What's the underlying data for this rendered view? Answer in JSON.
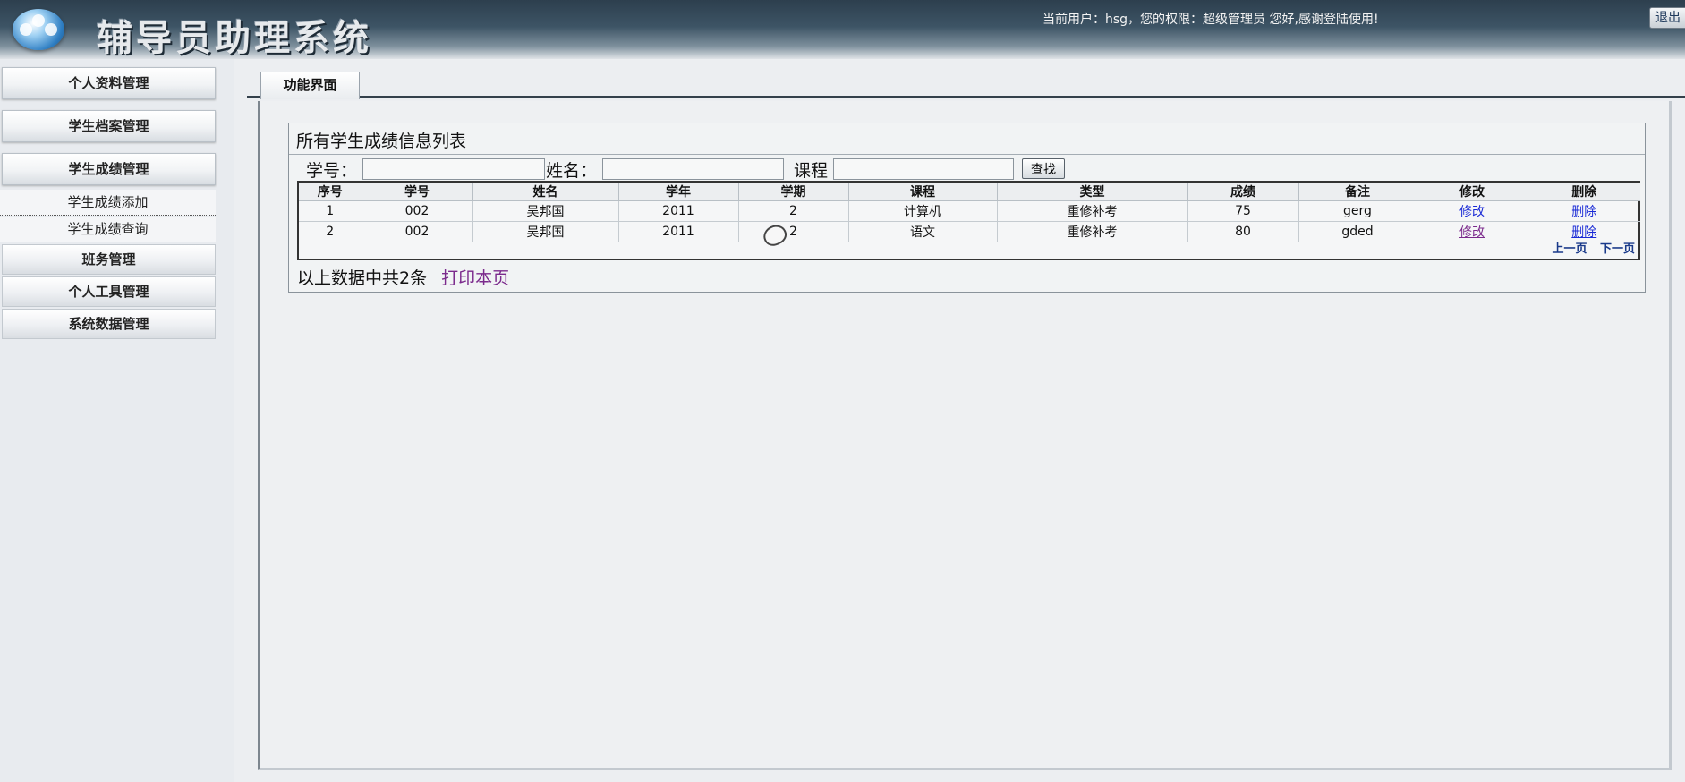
{
  "header": {
    "title": "辅导员助理系统",
    "user_info": "当前用户：hsg，您的权限：超级管理员  您好,感谢登陆使用!",
    "logout_label": "退出"
  },
  "sidebar": {
    "menus": [
      {
        "label": "个人资料管理"
      },
      {
        "label": "学生档案管理"
      },
      {
        "label": "学生成绩管理"
      }
    ],
    "sub_items": [
      {
        "label": "学生成绩添加"
      },
      {
        "label": "学生成绩查询"
      }
    ],
    "flat_menus": [
      {
        "label": "班务管理"
      },
      {
        "label": "个人工具管理"
      },
      {
        "label": "系统数据管理"
      }
    ]
  },
  "main": {
    "tab_label": "功能界面",
    "list_title": "所有学生成绩信息列表",
    "search": {
      "student_no_label": "学号：",
      "name_label": "姓名：",
      "course_label": "课程",
      "student_no_value": "",
      "name_value": "",
      "course_value": "",
      "button_label": "查找"
    },
    "table": {
      "headers": [
        "序号",
        "学号",
        "姓名",
        "学年",
        "学期",
        "课程",
        "类型",
        "成绩",
        "备注",
        "修改",
        "删除"
      ],
      "rows": [
        {
          "seq": "1",
          "student_no": "002",
          "name": "吴邦国",
          "year": "2011",
          "term": "2",
          "course": "计算机",
          "type": "重修补考",
          "score": "75",
          "note": "gerg",
          "edit": "修改",
          "delete": "删除"
        },
        {
          "seq": "2",
          "student_no": "002",
          "name": "吴邦国",
          "year": "2011",
          "term": "2",
          "course": "语文",
          "type": "重修补考",
          "score": "80",
          "note": "gded",
          "edit": "修改",
          "delete": "删除"
        }
      ]
    },
    "pager": {
      "prev": "上一页",
      "next": "下一页"
    },
    "footer": {
      "summary": "以上数据中共2条",
      "print_label": "打印本页"
    }
  }
}
